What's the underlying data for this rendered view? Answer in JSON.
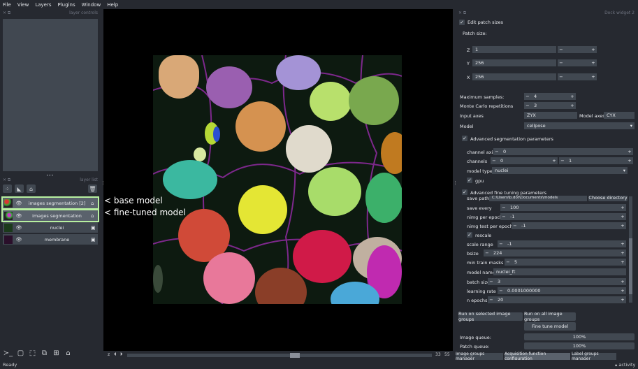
{
  "menu": [
    "File",
    "View",
    "Layers",
    "Plugins",
    "Window",
    "Help"
  ],
  "left_panel": {
    "controls_title": "layer controls",
    "list_title": "layer list",
    "layers": [
      {
        "name": "images segmentation [2]",
        "type_icon": "label-icon",
        "selected": true
      },
      {
        "name": "images segmentation",
        "type_icon": "label-icon",
        "selected": true
      },
      {
        "name": "nuclei",
        "type_icon": "image-icon",
        "selected": false
      },
      {
        "name": "membrane",
        "type_icon": "image-icon",
        "selected": false
      }
    ]
  },
  "annotations": {
    "base": "< base model",
    "fine": "< fine-tuned model"
  },
  "canvas": {
    "frame_current": "33",
    "frame_total": "55"
  },
  "dock": {
    "title": "Dock widget 2",
    "edit_patch_label": "Edit patch sizes",
    "patch_size_label": "Patch size:",
    "z_label": "Z",
    "z_value": "1",
    "y_label": "Y",
    "y_value": "256",
    "x_label": "X",
    "x_value": "256",
    "max_samples_label": "Maximum samples:",
    "max_samples": "4",
    "mc_label": "Monte Carlo repetitions",
    "mc_value": "3",
    "input_axes_label": "Input axes",
    "input_axes": "ZYX",
    "model_axes_label": "Model axes",
    "model_axes": "CYX",
    "model_label": "Model",
    "model_value": "cellpose",
    "adv_seg_label": "Advanced segmentation parameters",
    "channel_axis_label": "channel axis",
    "channel_axis": "0",
    "channels_label": "channels",
    "channels_a": "0",
    "channels_b": "1",
    "model_type_label": "model type",
    "model_type": "nuclei",
    "gpu_label": "gpu",
    "adv_ft_label": "Advanced fine tuning parameters",
    "save_path_label": "save path",
    "save_path": "C:\\Users\\b.dot\\Documents\\models",
    "choose_dir": "Choose directory",
    "save_every_label": "save every",
    "save_every": "100",
    "nimg_label": "nimg per epoch",
    "nimg": "-1",
    "nimg_test_label": "nimg test per epoch",
    "nimg_test": "-1",
    "rescale_label": "rescale",
    "scale_range_label": "scale range",
    "scale_range": "-1",
    "bsize_label": "bsize",
    "bsize": "224",
    "min_masks_label": "min train masks",
    "min_masks": "5",
    "model_name_label": "model name",
    "model_name": "nuclei_ft",
    "batch_label": "batch size",
    "batch": "3",
    "lr_label": "learning rate",
    "lr": "0.0001000000",
    "epochs_label": "n epochs",
    "epochs": "20",
    "run_selected": "Run on selected image groups",
    "run_all": "Run on all image groups",
    "fine_tune": "Fine tune model",
    "image_queue_label": "Image queue:",
    "image_queue": "100%",
    "patch_queue_label": "Patch queue:",
    "patch_queue": "100%"
  },
  "tabs": [
    "Image groups manager",
    "Acquisition function configuration",
    "Label groups manager"
  ],
  "status": {
    "left": "Ready",
    "right": "activity"
  }
}
